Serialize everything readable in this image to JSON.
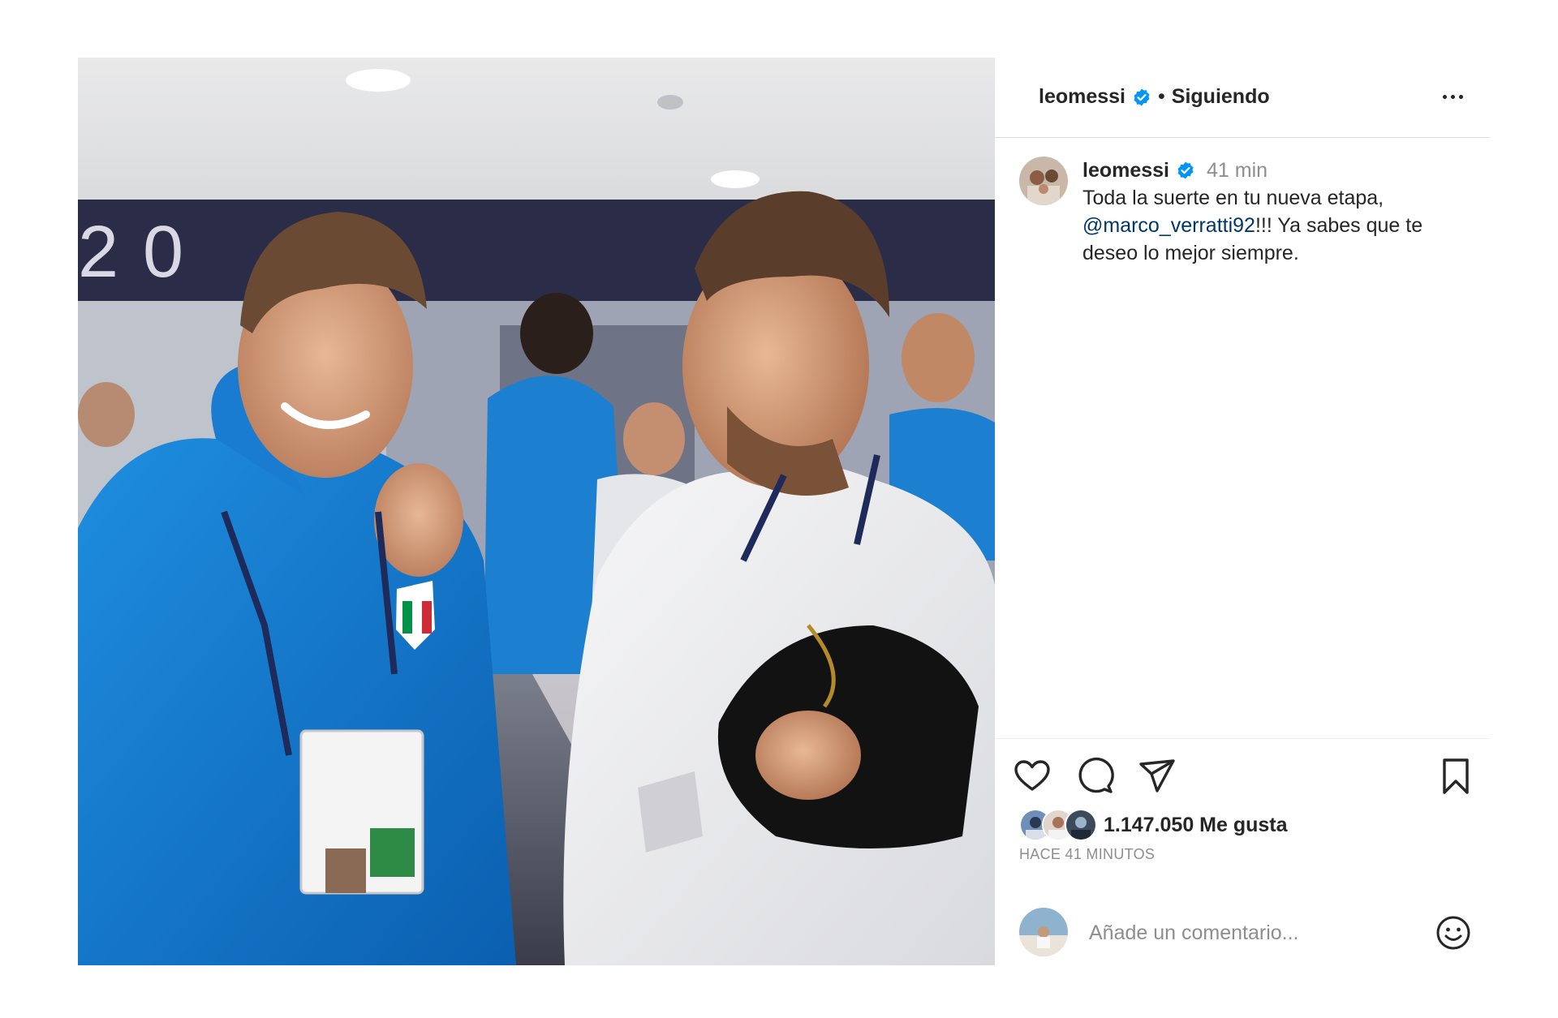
{
  "post": {
    "image_alt": "Two footballers smiling in a stadium tunnel"
  },
  "header": {
    "username": "leomessi",
    "separator": "•",
    "follow_status": "Siguiendo"
  },
  "caption": {
    "username": "leomessi",
    "time": "41 min",
    "text_before": "Toda la suerte en tu nueva etapa, ",
    "mention": "@marco_verratti92",
    "text_after": "!!! Ya sabes que te deseo lo mejor siempre."
  },
  "engagement": {
    "likes": "1.147.050 Me gusta",
    "time_ago": "HACE 41 MINUTOS"
  },
  "comment_box": {
    "placeholder": "Añade un comentario..."
  },
  "icons": {
    "verified": "verified-badge-icon",
    "more": "more-options-icon",
    "like": "heart-icon",
    "comment": "comment-bubble-icon",
    "share": "paper-plane-icon",
    "save": "bookmark-icon",
    "emoji": "smiley-icon"
  },
  "colors": {
    "verified_blue": "#0095f6",
    "mention": "#00376b",
    "muted": "#8e8e8e",
    "text": "#262626"
  }
}
